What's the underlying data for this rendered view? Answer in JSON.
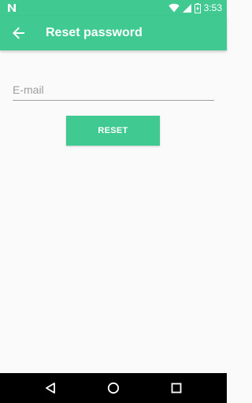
{
  "colors": {
    "accent": "#40c990",
    "background": "#fafafa",
    "nav_bar": "#000000"
  },
  "status_bar": {
    "time": "3:53",
    "icons": [
      "notification-n-icon",
      "wifi-icon",
      "cell-signal-icon",
      "battery-icon"
    ]
  },
  "app_bar": {
    "back_icon": "arrow-back-icon",
    "title": "Reset password"
  },
  "form": {
    "email_placeholder": "E-mail",
    "email_value": "",
    "reset_label": "RESET"
  },
  "nav_bar": {
    "icons": [
      "back-triangle-icon",
      "home-circle-icon",
      "recents-square-icon"
    ]
  }
}
